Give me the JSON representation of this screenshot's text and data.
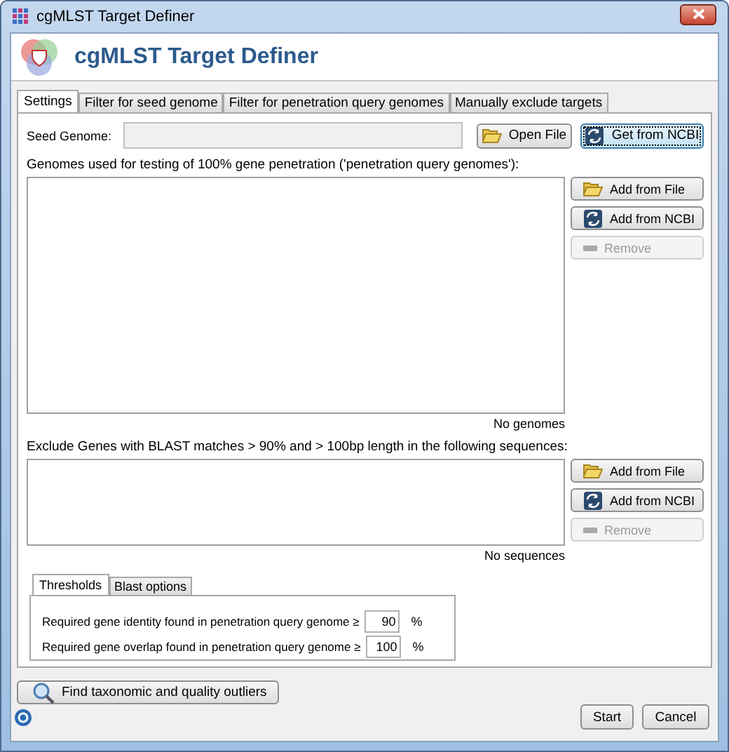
{
  "window": {
    "title": "cgMLST Target Definer"
  },
  "header": {
    "title": "cgMLST Target Definer"
  },
  "tabs": [
    {
      "label": "Settings",
      "selected": true
    },
    {
      "label": "Filter for seed genome",
      "selected": false
    },
    {
      "label": "Filter for penetration query genomes",
      "selected": false
    },
    {
      "label": "Manually exclude targets",
      "selected": false
    }
  ],
  "seed_genome": {
    "label": "Seed Genome:",
    "buttons": [
      {
        "label": "Open File",
        "kind": "file",
        "focused": false
      },
      {
        "label": "Get from NCBI",
        "kind": "ncbi",
        "focused": true
      }
    ]
  },
  "genome_lists": [
    {
      "label": "Genomes used for testing of 100% gene penetration ('penetration query genomes'):",
      "empty_text": "No genomes",
      "buttons": [
        {
          "label": "Add from File",
          "kind": "file",
          "disabled": false
        },
        {
          "label": "Add from NCBI",
          "kind": "ncbi",
          "disabled": false
        },
        {
          "label": "Remove",
          "kind": "remove",
          "disabled": true
        }
      ]
    },
    {
      "label": "Exclude Genes with BLAST matches > 90% and > 100bp length in the following sequences:",
      "empty_text": "No sequences",
      "buttons": [
        {
          "label": "Add from File",
          "kind": "file",
          "disabled": false
        },
        {
          "label": "Add from NCBI",
          "kind": "ncbi",
          "disabled": false
        },
        {
          "label": "Remove",
          "kind": "remove",
          "disabled": true
        }
      ]
    }
  ],
  "option_tabs": [
    {
      "label": "Thresholds",
      "selected": true
    },
    {
      "label": "Blast options",
      "selected": false
    }
  ],
  "thresholds": [
    {
      "label": "Required gene identity found in penetration query genome ≥",
      "value": "90",
      "unit": "%"
    },
    {
      "label": "Required gene overlap found in penetration query genome ≥",
      "value": "100",
      "unit": "%"
    }
  ],
  "outliers_button": {
    "label": "Find taxonomic and quality outliers"
  },
  "footer_buttons": [
    "Start",
    "Cancel"
  ]
}
